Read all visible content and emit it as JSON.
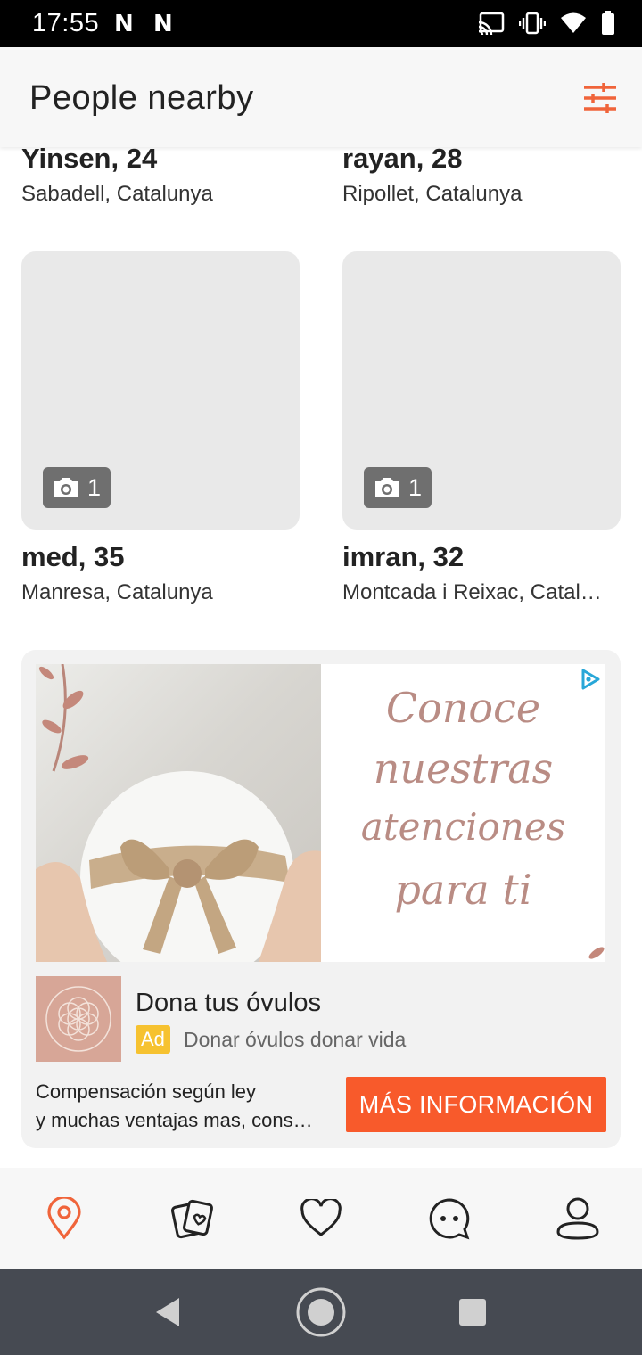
{
  "status": {
    "time": "17:55",
    "notif_1": "N",
    "notif_2": "N"
  },
  "app_bar": {
    "title": "People nearby",
    "filter_icon": "sliders-icon",
    "accent": "#f0643a"
  },
  "people": [
    {
      "name": "Yinsen, 24",
      "location": "Sabadell, Catalunya"
    },
    {
      "name": "rayan, 28",
      "location": "Ripollet, Catalunya"
    },
    {
      "name": "med, 35",
      "location": "Manresa, Catalunya",
      "photo_count": "1"
    },
    {
      "name": "imran, 32",
      "location": "Montcada i Reixac, Catal…",
      "photo_count": "1"
    }
  ],
  "ad": {
    "banner_lines": [
      "Conoce",
      "nuestras",
      "atenciones",
      "para ti"
    ],
    "title": "Dona tus óvulos",
    "badge": "Ad",
    "subtitle": "Donar óvulos donar vida",
    "body_line_1": "Compensación según ley",
    "body_line_2": "y muchas ventajas mas, cons…",
    "cta": "MÁS INFORMACIÓN",
    "cta_color": "#f85a2b"
  },
  "bottom_nav": {
    "items": [
      "location-pin-icon",
      "cards-icon",
      "heart-icon",
      "chat-icon",
      "profile-icon"
    ],
    "active": "location-pin-icon"
  },
  "system_nav": [
    "back-icon",
    "home-icon",
    "recents-icon"
  ]
}
